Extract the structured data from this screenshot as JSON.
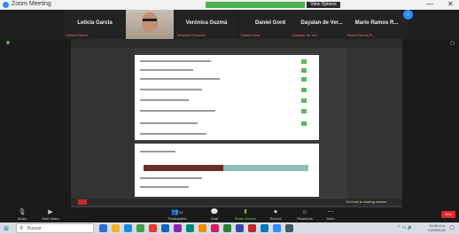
{
  "window": {
    "title": "Zoom Meeting",
    "view_options": "View Options",
    "minimize": "—",
    "close": "✕"
  },
  "participants_strip": {
    "tiles": [
      {
        "name": "Leticia García",
        "sub": "Leticia García"
      },
      {
        "name": "Verónica Guzmá",
        "sub": "Verónica Guzmán"
      },
      {
        "name": "Daniel Gord",
        "sub": "Daniel Gord"
      },
      {
        "name": "Dayalan de Ver...",
        "sub": "Dayalan de Ver..."
      },
      {
        "name": "Mario Ramos R...",
        "sub": "Mario Ramos R..."
      }
    ],
    "next_icon": "›"
  },
  "share": {
    "status_caption": "Un Host is sharing screen"
  },
  "toolbar": {
    "audio": "Audio",
    "video": "Start Video",
    "participants": "Participants",
    "participants_count": "31",
    "chat": "Chat",
    "share_screen": "Share Screen",
    "record": "Record",
    "reactions": "Reactions",
    "more": "More",
    "end": "End"
  },
  "taskbar": {
    "search_placeholder": "Buscar",
    "clock_time": "10:06 a.m.",
    "clock_date": "21/09/2020"
  }
}
